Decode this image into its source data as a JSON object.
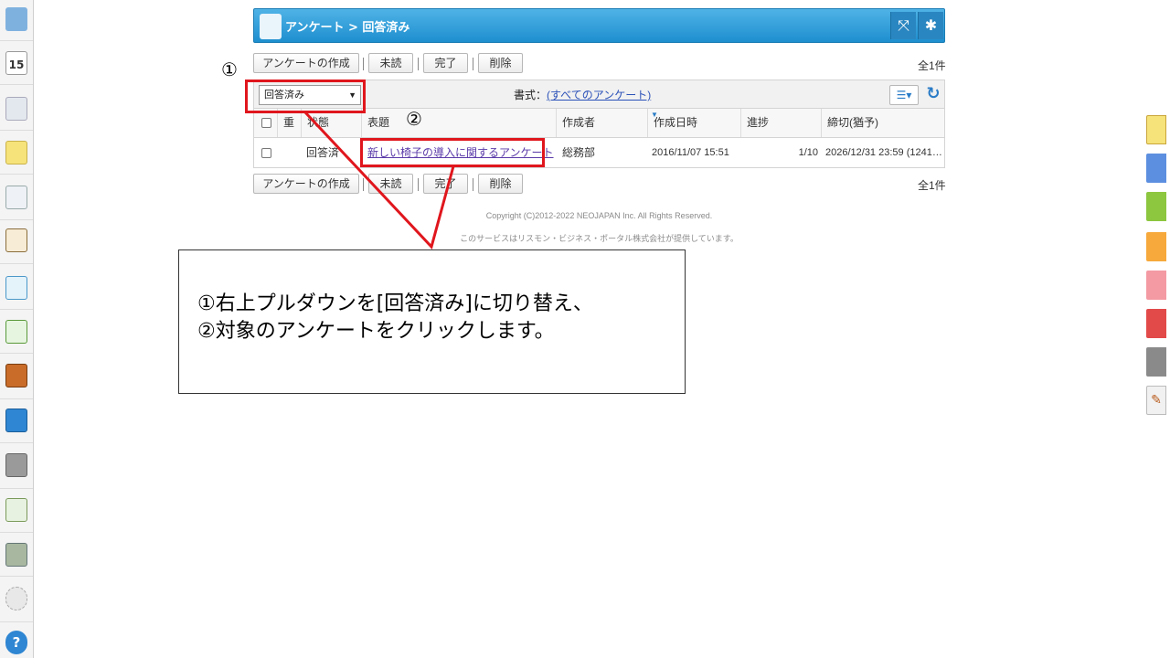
{
  "header": {
    "breadcrumb": "アンケート > 回答済み"
  },
  "toolbar": {
    "create_label": "アンケートの作成",
    "unread_label": "未読",
    "done_label": "完了",
    "delete_label": "削除",
    "count_label": "全1件"
  },
  "filter": {
    "status_value": "回答済み",
    "format_prefix": "書式：",
    "format_link": "(すべてのアンケート)"
  },
  "table": {
    "headers": [
      "重",
      "状態",
      "表題",
      "作成者",
      "作成日時",
      "進捗",
      "締切(猶予)"
    ],
    "rows": [
      {
        "status": "回答済",
        "title": "新しい椅子の導入に関するアンケート",
        "author": "総務部",
        "created": "2016/11/07 15:51",
        "progress": "1/10",
        "deadline": "2026/12/31 23:59 (1241…"
      }
    ]
  },
  "footer": {
    "copyright": "Copyright (C)2012-2022 NEOJAPAN Inc. All Rights Reserved.",
    "provider": "このサービスはリスモン・ビジネス・ポータル株式会社が提供しています。"
  },
  "annotation": {
    "marker1": "①",
    "marker2": "②",
    "line1": "①右上プルダウンを[回答済み]に切り替え、",
    "line2": "②対象のアンケートをクリックします。"
  },
  "dock": {
    "calendar_day": "15"
  },
  "colors": {
    "accent_blue": "#1e8fcf",
    "annotation_red": "#e0161d",
    "link_purple": "#5a3aa8"
  }
}
